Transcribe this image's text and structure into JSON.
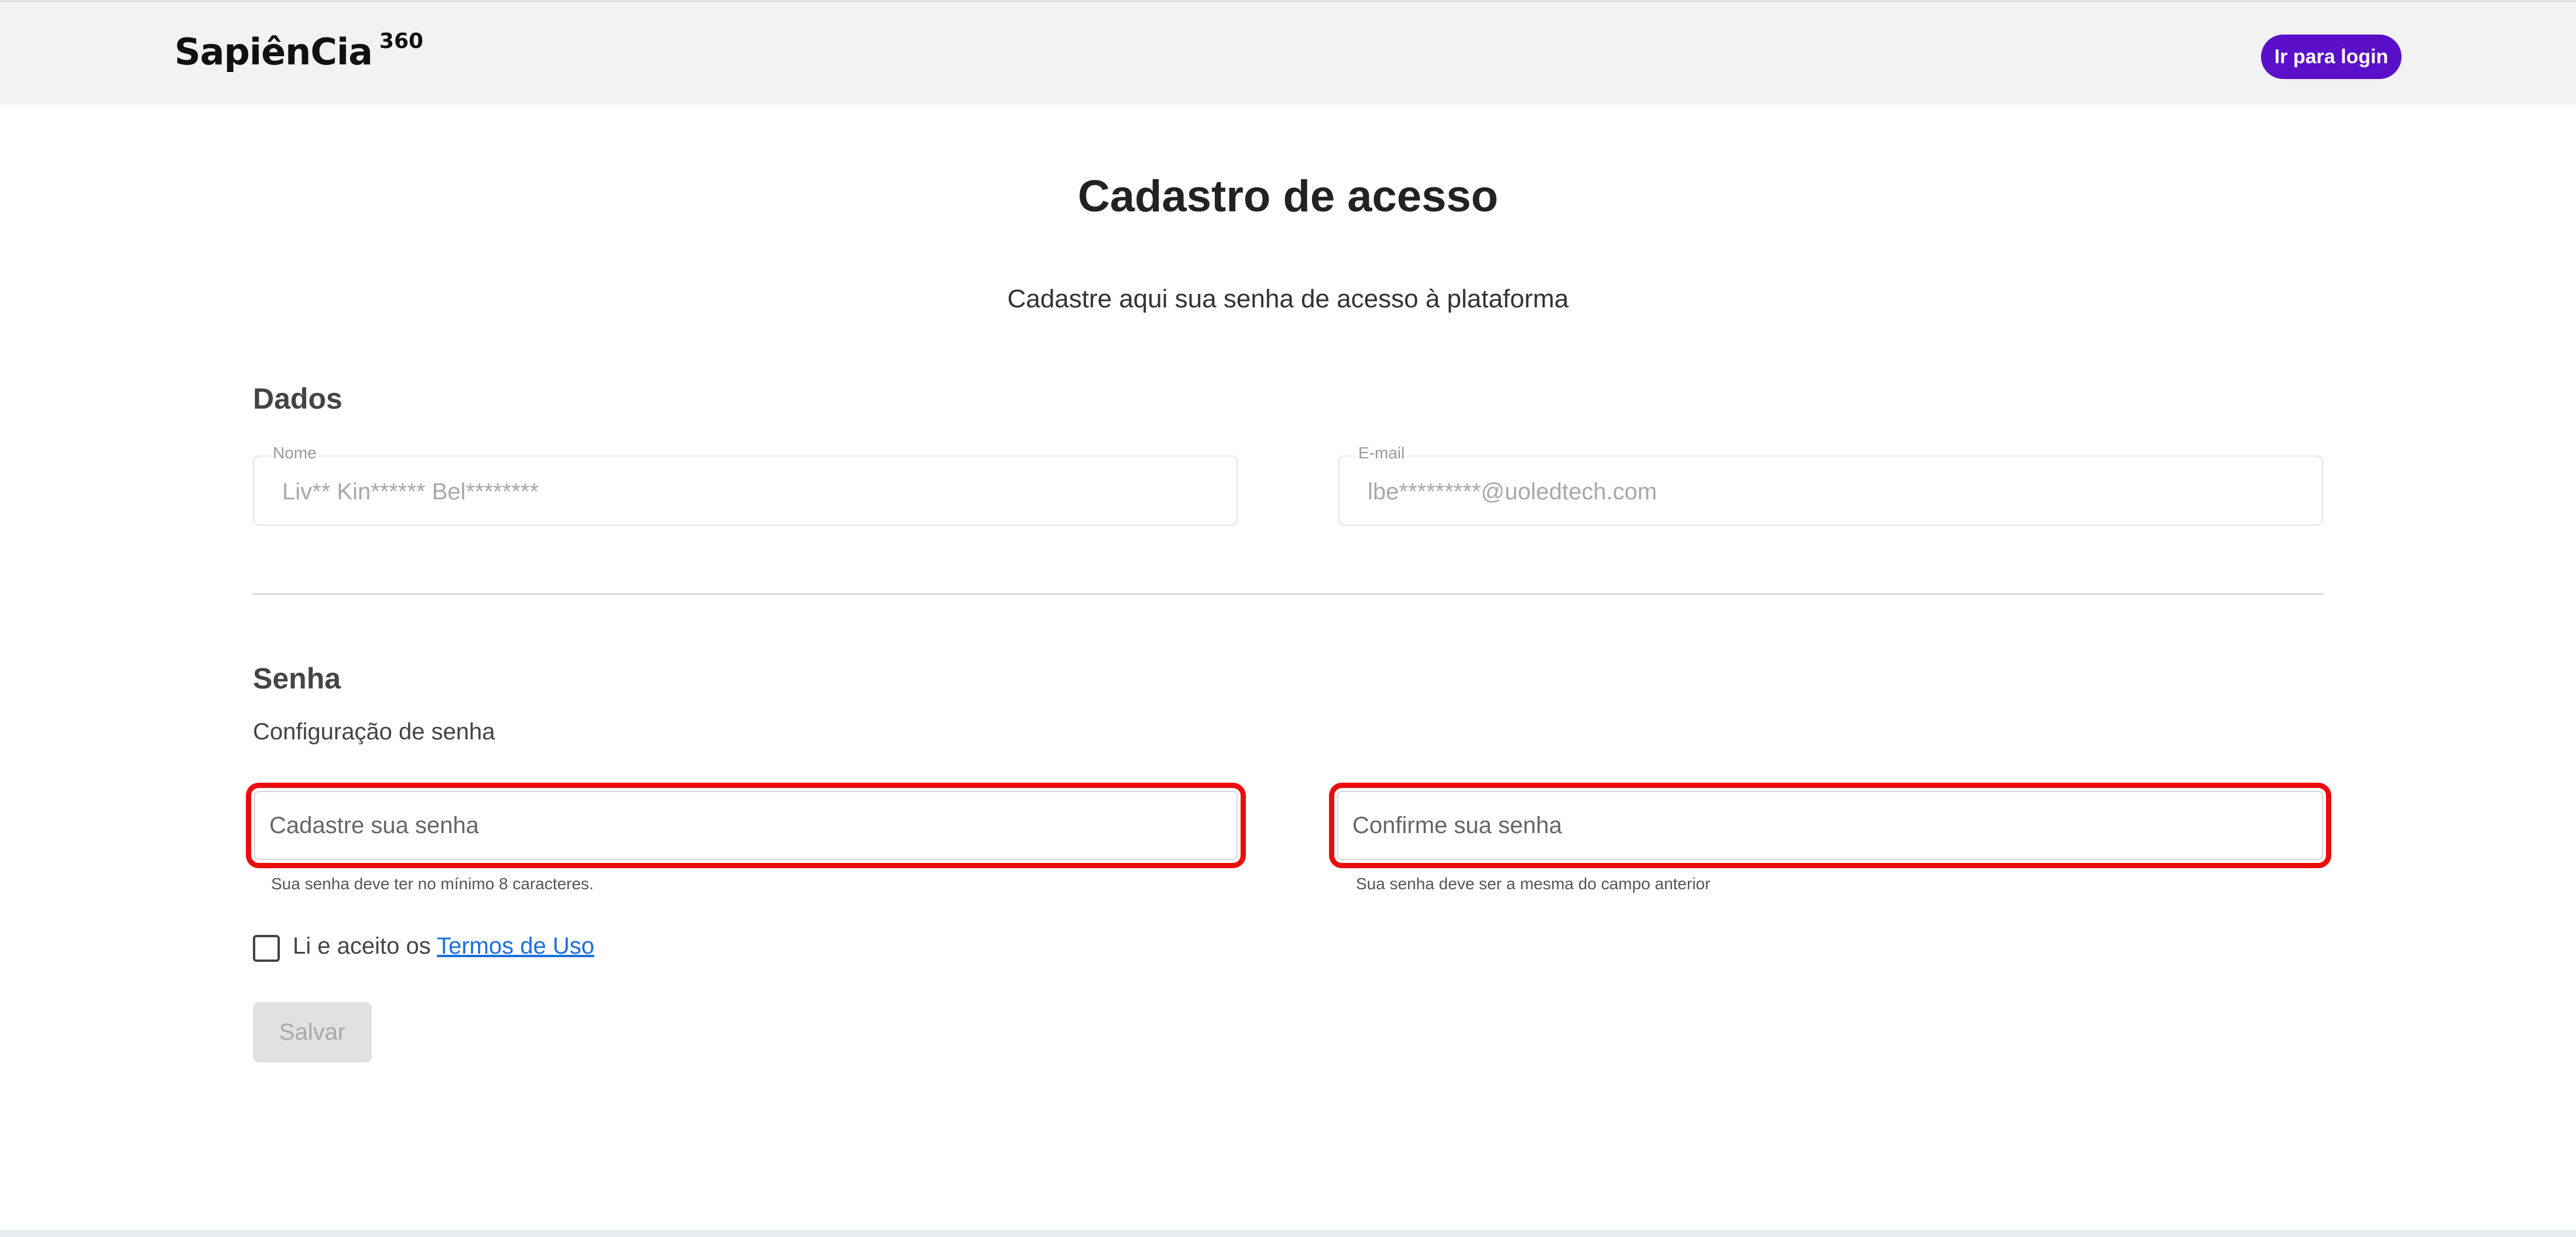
{
  "header": {
    "logo_text": "SapiênCia",
    "logo_suffix": "360",
    "login_button": "Ir para login"
  },
  "page": {
    "title": "Cadastro de acesso",
    "subtitle": "Cadastre aqui sua senha de acesso à plataforma"
  },
  "dados": {
    "section_title": "Dados",
    "name_label": "Nome",
    "name_value": "Liv** Kin****** Bel********",
    "email_label": "E-mail",
    "email_value": "lbe*********@uoledtech.com"
  },
  "senha": {
    "section_title": "Senha",
    "config_label": "Configuração de senha",
    "password_placeholder": "Cadastre sua senha",
    "password_hint": "Sua senha deve ter no mínimo 8 caracteres.",
    "confirm_placeholder": "Confirme sua senha",
    "confirm_hint": "Sua senha deve ser a mesma do campo anterior"
  },
  "terms": {
    "prefix": "Li e aceito os",
    "link": "Termos de Uso",
    "checked": false
  },
  "actions": {
    "save_label": "Salvar",
    "save_enabled": false
  },
  "colors": {
    "brand_purple": "#5a0fc8",
    "highlight_red": "#ec0c0c",
    "link_blue": "#1a6fe0",
    "header_bg": "#f2f2f2"
  }
}
